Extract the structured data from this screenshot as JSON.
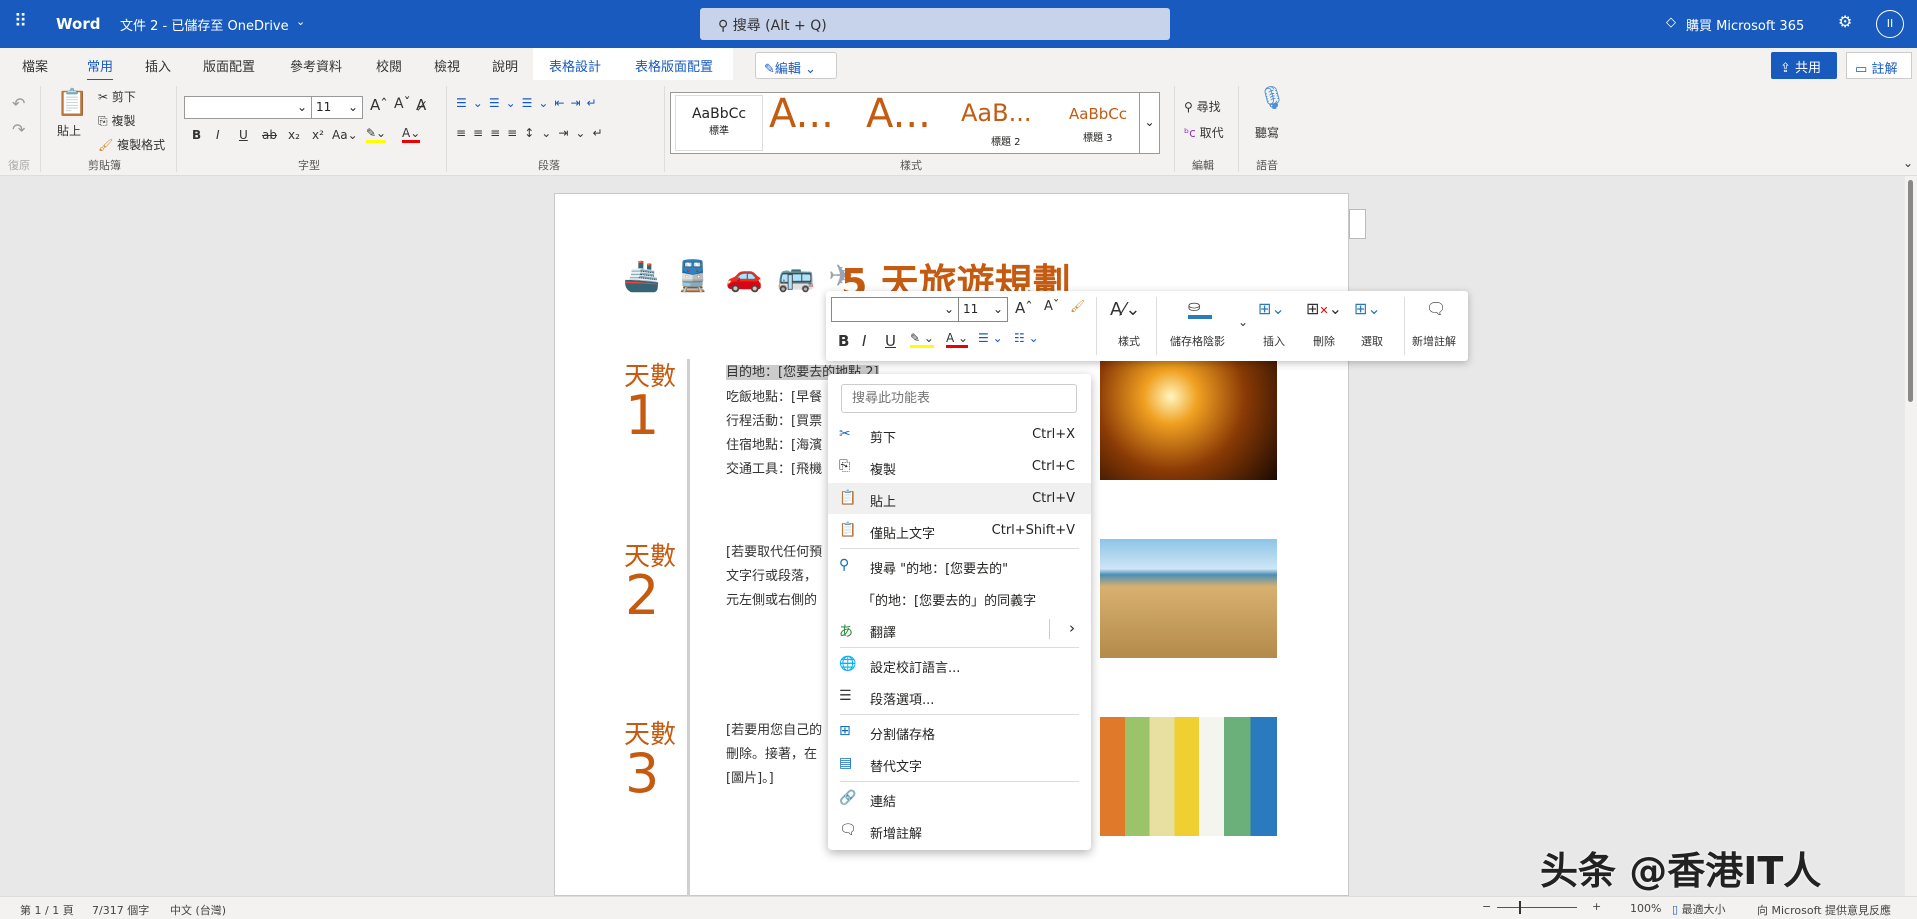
{
  "titlebar": {
    "app": "Word",
    "doc": "文件 2 - 已儲存至 OneDrive",
    "search": "搜尋 (Alt + Q)",
    "buy": "購買 Microsoft 365",
    "avatar": "II"
  },
  "tabs": [
    "檔案",
    "常用",
    "插入",
    "版面配置",
    "參考資料",
    "校閱",
    "檢視",
    "說明",
    "表格設計",
    "表格版面配置"
  ],
  "edit_mode": "編輯",
  "share": "共用",
  "comment": "註解",
  "ribbon": {
    "undo_group": "復原",
    "clipboard": {
      "paste": "貼上",
      "cut": "剪下",
      "copy": "複製",
      "format_painter": "複製格式",
      "label": "剪貼簿"
    },
    "font": {
      "name": "",
      "size": "11",
      "label": "字型",
      "bold": "B",
      "italic": "I",
      "underline": "U",
      "change_case": "Aa"
    },
    "paragraph": {
      "label": "段落"
    },
    "styles": {
      "label": "樣式",
      "items": [
        {
          "preview": "AaBbCc",
          "name": "標準"
        },
        {
          "preview": "A...",
          "name": ""
        },
        {
          "preview": "A...",
          "name": ""
        },
        {
          "preview": "AaB...",
          "name": "標題 2"
        },
        {
          "preview": "AaBbCc",
          "name": "標題 3"
        }
      ]
    },
    "editing": {
      "find": "尋找",
      "replace": "取代",
      "label": "編輯"
    },
    "voice": {
      "dictate": "聽寫",
      "label": "語音"
    }
  },
  "document": {
    "title": "5 天旅遊規劃",
    "days": [
      {
        "label": "天數",
        "num": "1",
        "lines": [
          "目的地：[您要去的地點 2]",
          "吃飯地點：[早餐",
          "行程活動：[買票",
          "住宿地點：[海濱",
          "交通工具：[飛機"
        ]
      },
      {
        "label": "天數",
        "num": "2",
        "lines": [
          "[若要取代任何預",
          "文字行或段落，",
          "元左側或右側的"
        ]
      },
      {
        "label": "天數",
        "num": "3",
        "lines": [
          "[若要用您自己的",
          "刪除。接著，在",
          "[圖片]。]"
        ]
      }
    ]
  },
  "mini_toolbar": {
    "font": "",
    "size": "11",
    "styles": "樣式",
    "shading": "儲存格陰影",
    "insert": "插入",
    "delete": "刪除",
    "select": "選取",
    "new_comment": "新增註解"
  },
  "context_menu": {
    "search_placeholder": "搜尋此功能表",
    "items": [
      {
        "label": "剪下",
        "shortcut": "Ctrl+X",
        "icon": "scissors-icon"
      },
      {
        "label": "複製",
        "shortcut": "Ctrl+C",
        "icon": "copy-icon"
      },
      {
        "label": "貼上",
        "shortcut": "Ctrl+V",
        "icon": "paste-icon"
      },
      {
        "label": "僅貼上文字",
        "shortcut": "Ctrl+Shift+V",
        "icon": "paste-text-icon"
      },
      {
        "label": "搜尋 \"的地：[您要去的\"",
        "icon": "search-icon"
      },
      {
        "label": "「的地：[您要去的」的同義字"
      },
      {
        "label": "翻譯",
        "icon": "translate-icon"
      },
      {
        "label": "設定校訂語言...",
        "icon": "language-icon"
      },
      {
        "label": "段落選項...",
        "icon": "paragraph-icon"
      },
      {
        "label": "分割儲存格",
        "icon": "split-cells-icon"
      },
      {
        "label": "替代文字",
        "icon": "alt-text-icon"
      },
      {
        "label": "連結",
        "icon": "link-icon"
      },
      {
        "label": "新增註解",
        "icon": "comment-icon"
      }
    ]
  },
  "status": {
    "page": "第 1 / 1 頁",
    "words": "7/317 個字",
    "lang": "中文 (台灣)",
    "zoom": "100%",
    "fit": "最適大小",
    "feedback": "向 Microsoft 提供意見反應"
  },
  "watermark": "头条 @香港IT人",
  "colors": {
    "brand": "#185abd",
    "accent": "#c55a11"
  }
}
